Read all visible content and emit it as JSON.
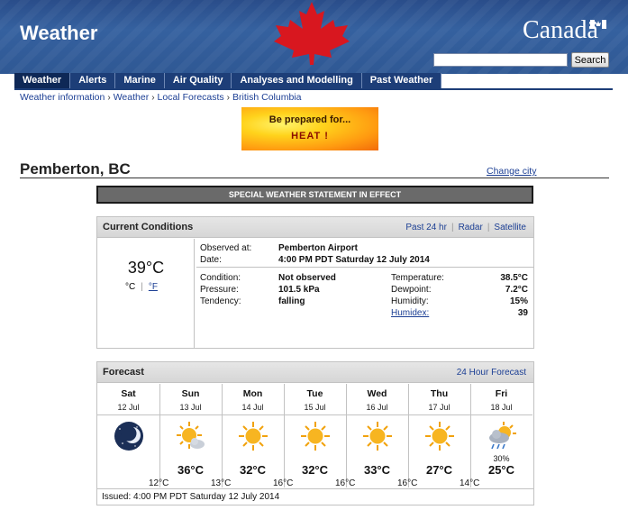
{
  "header": {
    "site_title": "Weather",
    "wordmark": "Canadä",
    "search_button": "Search",
    "search_placeholder": ""
  },
  "nav": {
    "items": [
      {
        "label": "Weather"
      },
      {
        "label": "Alerts"
      },
      {
        "label": "Marine"
      },
      {
        "label": "Air Quality"
      },
      {
        "label": "Analyses and Modelling"
      },
      {
        "label": "Past Weather"
      }
    ]
  },
  "breadcrumb": [
    "Weather information",
    "Weather",
    "Local Forecasts",
    "British Columbia"
  ],
  "banner": {
    "line1": "Be prepared for...",
    "line2": "HEAT !"
  },
  "city": {
    "name": "Pemberton, BC",
    "change_link": "Change city"
  },
  "statement": "SPECIAL WEATHER STATEMENT IN EFFECT",
  "current": {
    "title": "Current Conditions",
    "links": [
      "Past 24 hr",
      "Radar",
      "Satellite"
    ],
    "temp": "39°C",
    "unit_c": "°C",
    "unit_f": "°F",
    "observed_label": "Observed at:",
    "observed_value": "Pemberton Airport",
    "date_label": "Date:",
    "date_value": "4:00 PM PDT Saturday 12 July 2014",
    "condition_label": "Condition:",
    "condition_value": "Not observed",
    "pressure_label": "Pressure:",
    "pressure_value": "101.5 kPa",
    "tendency_label": "Tendency:",
    "tendency_value": "falling",
    "temperature_label": "Temperature:",
    "temperature_value": "38.5°C",
    "dewpoint_label": "Dewpoint:",
    "dewpoint_value": "7.2°C",
    "humidity_label": "Humidity:",
    "humidity_value": "15%",
    "humidex_label": "Humidex:",
    "humidex_value": "39"
  },
  "forecast": {
    "title": "Forecast",
    "link": "24 Hour Forecast",
    "days": [
      {
        "name": "Sat",
        "date": "12 Jul",
        "icon": "moon-icon",
        "pop": "",
        "high": ""
      },
      {
        "name": "Sun",
        "date": "13 Jul",
        "icon": "sun-cloud-icon",
        "pop": "",
        "high": "36°C"
      },
      {
        "name": "Mon",
        "date": "14 Jul",
        "icon": "sun-icon",
        "pop": "",
        "high": "32°C"
      },
      {
        "name": "Tue",
        "date": "15 Jul",
        "icon": "sun-icon",
        "pop": "",
        "high": "32°C"
      },
      {
        "name": "Wed",
        "date": "16 Jul",
        "icon": "sun-icon",
        "pop": "",
        "high": "33°C"
      },
      {
        "name": "Thu",
        "date": "17 Jul",
        "icon": "sun-icon",
        "pop": "",
        "high": "27°C"
      },
      {
        "name": "Fri",
        "date": "18 Jul",
        "icon": "sun-cloud-rain-icon",
        "pop": "30%",
        "high": "25°C"
      }
    ],
    "lows": [
      "12°C",
      "13°C",
      "16°C",
      "16°C",
      "16°C",
      "14°C"
    ],
    "issued": "Issued: 4:00 PM PDT Saturday 12 July 2014"
  }
}
